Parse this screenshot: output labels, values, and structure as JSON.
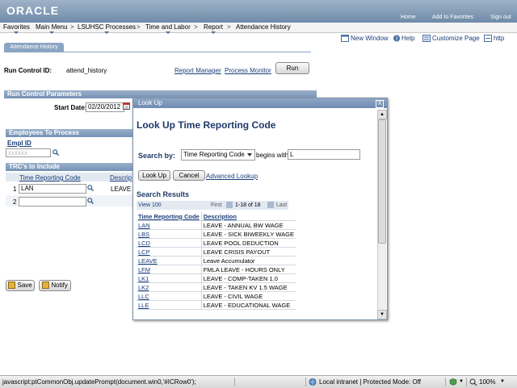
{
  "header": {
    "logo": "ORACLE",
    "links": [
      "Home",
      "Add to Favorites",
      "Sign out"
    ]
  },
  "menu": {
    "items": [
      "Favorites",
      "Main Menu",
      "LSUHSC Processes",
      "Time and Labor",
      "Report",
      "Attendance History"
    ],
    "separators": [
      ">",
      ">",
      ">",
      ">"
    ]
  },
  "toolbar": {
    "links": [
      "New Window",
      "Help",
      "Customize Page",
      "http"
    ]
  },
  "tab": {
    "label": "Attendance History"
  },
  "run_control": {
    "label": "Run Control ID:",
    "value": "attend_history",
    "report_manager": "Report Manager",
    "process_monitor": "Process Monitor",
    "run_button": "Run"
  },
  "params": {
    "header": "Run Control Parameters",
    "start_date_label": "Start Date:",
    "start_date_value": "02/20/2012"
  },
  "employees": {
    "header": "Employees To Process",
    "col_header": "Empl ID",
    "value": "xxxxxx"
  },
  "trc": {
    "header": "TRC's to Include",
    "col_code": "Time Reporting Code",
    "col_desc": "Descrip",
    "rows": [
      {
        "num": "1",
        "code": "LAN",
        "desc": "LEAVE -"
      },
      {
        "num": "2",
        "code": "",
        "desc": ""
      }
    ]
  },
  "bottom_buttons": {
    "save": "Save",
    "notify": "Notify"
  },
  "modal": {
    "header": "Look Up",
    "close": "X",
    "title": "Look Up Time Reporting Code",
    "search_by_label": "Search by:",
    "search_by_value": "Time Reporting Code",
    "begins_with": "begins with",
    "search_value": "L",
    "lookup_button": "Look Up",
    "cancel_button": "Cancel",
    "advanced_lookup": "Advanced Lookup",
    "results_title": "Search Results",
    "nav": {
      "view": "View 100",
      "first": "First",
      "range": "1-18 of 18",
      "last": "Last"
    },
    "col_code": "Time Reporting Code",
    "col_desc": "Description",
    "results": [
      {
        "code": "LAN",
        "desc": "LEAVE - ANNUAL BW WAGE"
      },
      {
        "code": "LBS",
        "desc": "LEAVE - SICK BIWEEKLY WAGE"
      },
      {
        "code": "LCD",
        "desc": "LEAVE POOL DEDUCTION"
      },
      {
        "code": "LCP",
        "desc": "LEAVE CRISIS PAYOUT"
      },
      {
        "code": "LEAVE",
        "desc": "Leave Accumulator"
      },
      {
        "code": "LFM",
        "desc": "FMLA LEAVE - HOURS ONLY"
      },
      {
        "code": "LK1",
        "desc": "LEAVE -  COMP-TAKEN 1.0"
      },
      {
        "code": "LK2",
        "desc": "LEAVE - TAKEN KV 1.5 WAGE"
      },
      {
        "code": "LLC",
        "desc": "LEAVE - CIVIL WAGE"
      },
      {
        "code": "LLE",
        "desc": "LEAVE - EDUCATIONAL WAGE"
      }
    ]
  },
  "statusbar": {
    "url": "javascript:ptCommonObj.updatePrompt(document.win0,'#ICRow0');",
    "zone": "Local intranet | Protected Mode: Off",
    "zoom": "100%"
  },
  "colors": {
    "header": "#7f98b6",
    "link": "#1a3d78",
    "title": "#1f3a6a"
  }
}
